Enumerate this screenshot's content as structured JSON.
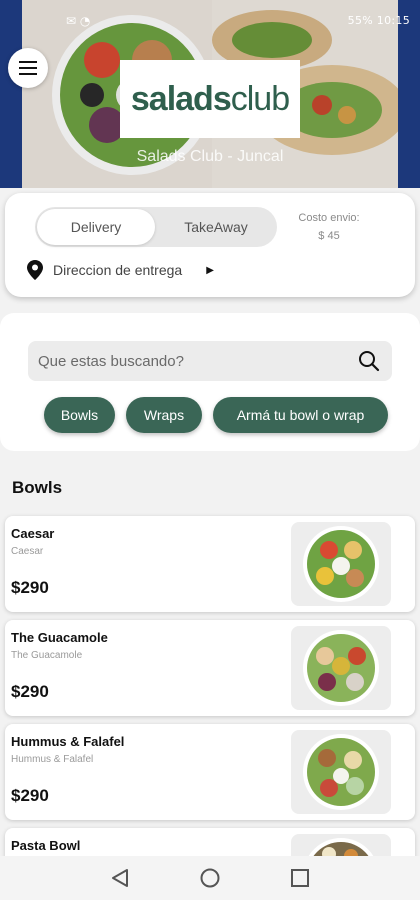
{
  "status": {
    "time": "10:15",
    "battery": "55%"
  },
  "header": {
    "logo_bold": "salads",
    "logo_light": "club",
    "store_name": "Salads Club - Juncal"
  },
  "order_mode": {
    "delivery": "Delivery",
    "takeaway": "TakeAway",
    "fee_label": "Costo envio:",
    "fee_value": "$ 45"
  },
  "address": {
    "label": "Direccion de entrega"
  },
  "search": {
    "placeholder": "Que estas buscando?"
  },
  "categories": [
    "Bowls",
    "Wraps",
    "Armá tu bowl o wrap"
  ],
  "section": {
    "title": "Bowls"
  },
  "products": [
    {
      "name": "Caesar",
      "description": "Caesar",
      "price": "$290"
    },
    {
      "name": "The Guacamole",
      "description": "The Guacamole",
      "price": "$290"
    },
    {
      "name": "Hummus & Falafel",
      "description": "Hummus & Falafel",
      "price": "$290"
    },
    {
      "name": "Pasta Bowl",
      "description": "",
      "price": ""
    }
  ],
  "colors": {
    "brand": "#2f5f4d",
    "chip": "#3a6656",
    "hero_blue": "#1f3d86"
  },
  "icons": [
    "menu-icon",
    "location-pin-icon",
    "caret-right-icon",
    "search-icon",
    "back-icon",
    "home-icon",
    "recents-icon"
  ]
}
